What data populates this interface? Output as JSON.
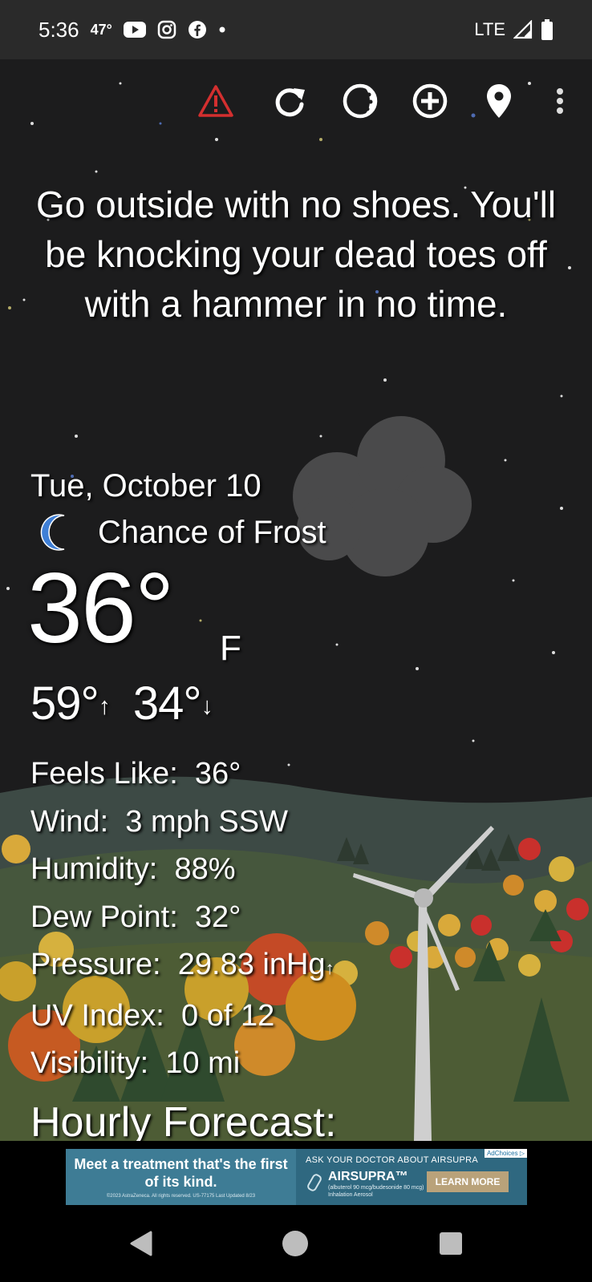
{
  "status_bar": {
    "time": "5:36",
    "temp": "47°",
    "network": "LTE",
    "icons": [
      "youtube-icon",
      "instagram-icon",
      "facebook-icon",
      "dot-icon",
      "signal-icon",
      "battery-icon"
    ]
  },
  "toolbar": {
    "icons": [
      "alert-icon",
      "refresh-icon",
      "theme-icon",
      "add-location-icon",
      "location-pin-icon",
      "more-vert-icon"
    ],
    "alert_color": "#d32f2f"
  },
  "headline": "Go outside with no shoes. You'll be knocking your dead toes off with a hammer in no time.",
  "current": {
    "date": "Tue, October 10",
    "condition": "Chance of Frost",
    "condition_icon": "moon-icon",
    "temperature": "36°",
    "unit": "F",
    "high": "59°",
    "low": "34°",
    "high_arrow": "↑",
    "low_arrow": "↓"
  },
  "details": [
    {
      "label": "Feels Like:",
      "value": "36°"
    },
    {
      "label": "Wind:",
      "value": "3 mph SSW"
    },
    {
      "label": "Humidity:",
      "value": "88%"
    },
    {
      "label": "Dew Point:",
      "value": "32°"
    },
    {
      "label": "Pressure:",
      "value": "29.83 inHg",
      "trend": "↑"
    },
    {
      "label": "UV Index:",
      "value": "0 of 12"
    },
    {
      "label": "Visibility:",
      "value": "10 mi"
    }
  ],
  "hourly_title": "Hourly Forecast:",
  "ad": {
    "headline": "Meet a treatment that's the first of its kind.",
    "copyright": "©2023 AstraZeneca. All rights reserved. US-77175 Last Updated 8/23",
    "ask": "ASK YOUR DOCTOR ABOUT AIRSUPRA",
    "brand": "AIRSUPRA™",
    "fine_print_1": "(albuterol 90 mcg/budesonide 80 mcg)",
    "fine_print_2": "Inhalation Aerosol",
    "cta": "LEARN MORE",
    "choices": "AdChoices ▷"
  },
  "nav": {
    "icons": [
      "back-icon",
      "home-icon",
      "recents-icon"
    ]
  },
  "colors": {
    "status_bg": "#2a2a2a",
    "sky": "#1c1c1d",
    "moon": "#3f7fd6",
    "ad_bg": "#2f6880"
  }
}
